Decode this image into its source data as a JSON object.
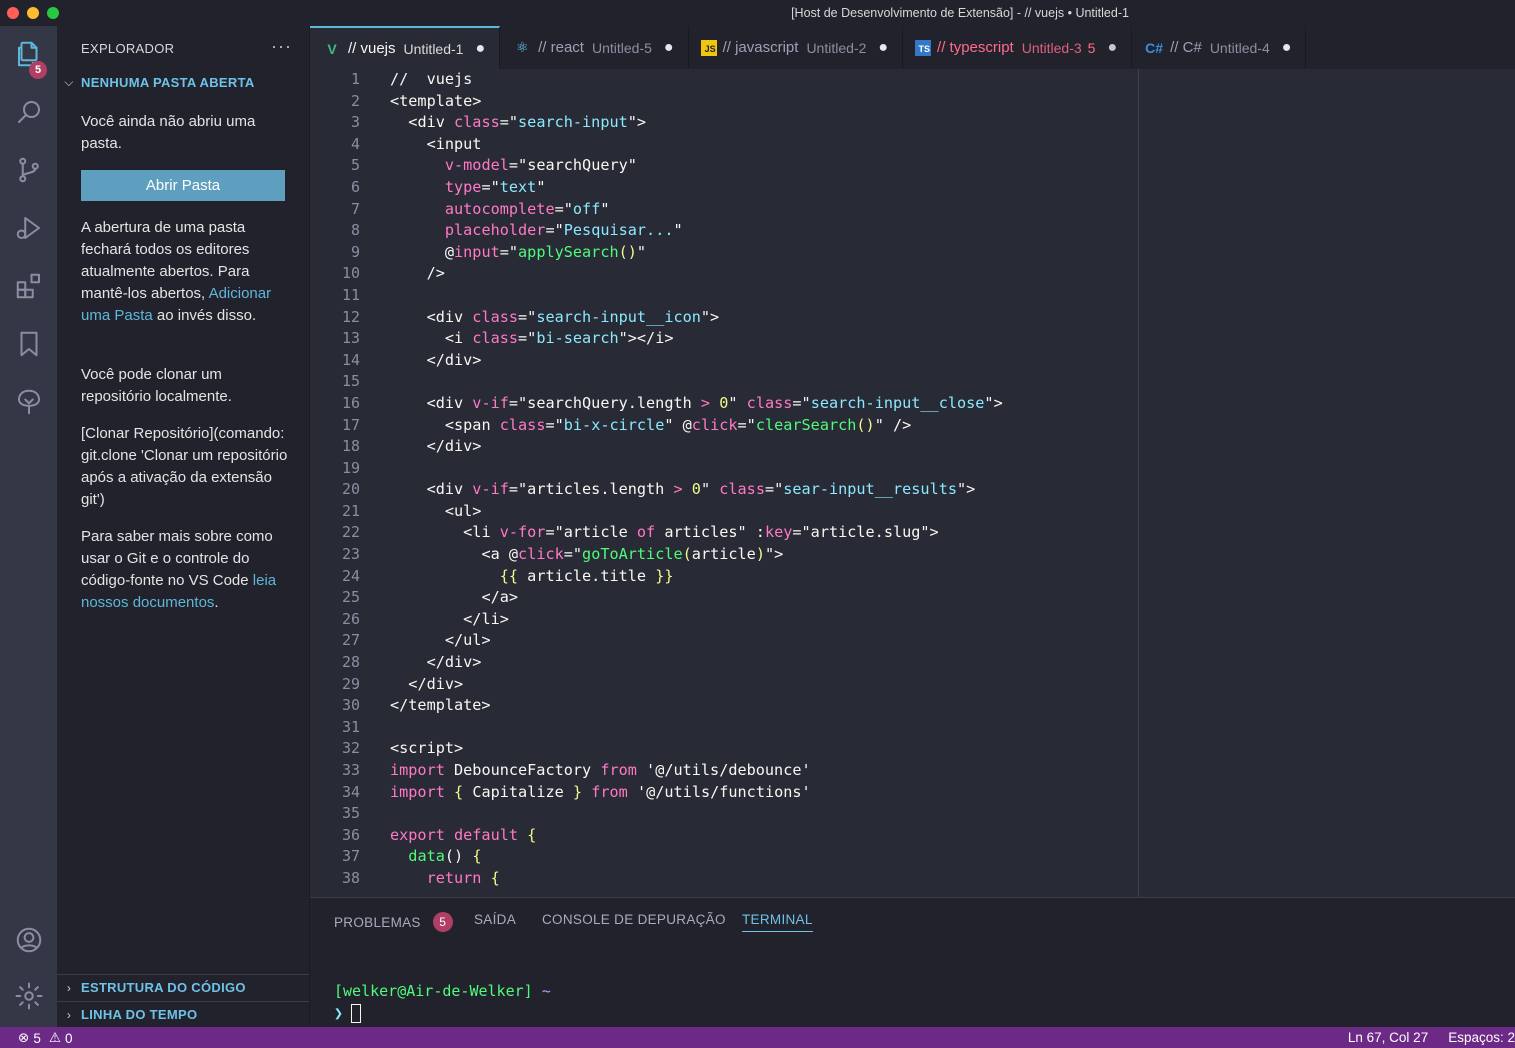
{
  "window": {
    "title": "[Host de Desenvolvimento de Extensão] - // vuejs • Untitled-1"
  },
  "activity": {
    "explorer_badge": "5"
  },
  "sidebar": {
    "title": "EXPLORADOR",
    "more": "···",
    "section_no_folder": "NENHUMA PASTA ABERTA",
    "para1": "Você ainda não abriu uma pasta.",
    "open_folder_button": "Abrir Pasta",
    "para2_a": "A abertura de uma pasta fechará todos os editores atualmente abertos. Para mantê-los abertos, ",
    "para2_link": "Adicionar uma Pasta",
    "para2_b": " ao invés disso.",
    "para3": "Você pode clonar um repositório localmente.",
    "para4": "[Clonar Repositório](comando: git.clone 'Clonar um repositório após a ativação da extensão git')",
    "para5_a": "Para saber mais sobre como usar o Git e o controle do código-fonte no VS Code ",
    "para5_link": "leia nossos documentos",
    "para5_b": ".",
    "section_outline": "ESTRUTURA DO CÓDIGO",
    "section_timeline": "LINHA DO TEMPO"
  },
  "tabs": [
    {
      "icon": "V",
      "icon_color": "#42b883",
      "name": "// vuejs",
      "sub": "Untitled-1",
      "count": "",
      "dot": "●"
    },
    {
      "icon": "⚛",
      "icon_color": "#61dafb",
      "name": "// react",
      "sub": "Untitled-5",
      "count": "",
      "dot": "●"
    },
    {
      "icon": "JS",
      "icon_color": "#f1c40f",
      "name": "// javascript",
      "sub": "Untitled-2",
      "count": "",
      "dot": "●"
    },
    {
      "icon": "TS",
      "icon_color": "#3178c6",
      "name": "// typescript",
      "sub": "Untitled-3",
      "count": "5",
      "dot": "●"
    },
    {
      "icon": "C#",
      "icon_color": "#3a8dde",
      "name": "// C#",
      "sub": "Untitled-4",
      "count": "",
      "dot": "●"
    }
  ],
  "editor": {
    "lines": [
      [
        [
          "t-pl",
          "//  vuejs"
        ]
      ],
      [
        [
          "t-tag",
          "<template>"
        ]
      ],
      [
        [
          "t-pl",
          "  "
        ],
        [
          "t-tag",
          "<div "
        ],
        [
          "t-attr",
          "class"
        ],
        [
          "t-pl",
          "=\""
        ],
        [
          "t-str",
          "search-input"
        ],
        [
          "t-pl",
          "\">"
        ]
      ],
      [
        [
          "t-pl",
          "    "
        ],
        [
          "t-tag",
          "<input"
        ]
      ],
      [
        [
          "t-pl",
          "      "
        ],
        [
          "t-attr",
          "v-model"
        ],
        [
          "t-pl",
          "=\""
        ],
        [
          "t-pl",
          "searchQuery"
        ],
        [
          "t-pl",
          "\""
        ]
      ],
      [
        [
          "t-pl",
          "      "
        ],
        [
          "t-attr",
          "type"
        ],
        [
          "t-pl",
          "=\""
        ],
        [
          "t-str",
          "text"
        ],
        [
          "t-pl",
          "\""
        ]
      ],
      [
        [
          "t-pl",
          "      "
        ],
        [
          "t-attr",
          "autocomplete"
        ],
        [
          "t-pl",
          "=\""
        ],
        [
          "t-str",
          "off"
        ],
        [
          "t-pl",
          "\""
        ]
      ],
      [
        [
          "t-pl",
          "      "
        ],
        [
          "t-attr",
          "placeholder"
        ],
        [
          "t-pl",
          "=\""
        ],
        [
          "t-str",
          "Pesquisar..."
        ],
        [
          "t-pl",
          "\""
        ]
      ],
      [
        [
          "t-pl",
          "      @"
        ],
        [
          "t-attr",
          "input"
        ],
        [
          "t-pl",
          "=\""
        ],
        [
          "t-fn",
          "applySearch"
        ],
        [
          "t-br",
          "()"
        ],
        [
          "t-pl",
          "\""
        ]
      ],
      [
        [
          "t-pl",
          "    />"
        ]
      ],
      [
        [
          "t-pl",
          ""
        ]
      ],
      [
        [
          "t-pl",
          "    "
        ],
        [
          "t-tag",
          "<div "
        ],
        [
          "t-attr",
          "class"
        ],
        [
          "t-pl",
          "=\""
        ],
        [
          "t-str",
          "search-input__icon"
        ],
        [
          "t-pl",
          "\">"
        ]
      ],
      [
        [
          "t-pl",
          "      "
        ],
        [
          "t-tag",
          "<i "
        ],
        [
          "t-attr",
          "class"
        ],
        [
          "t-pl",
          "=\""
        ],
        [
          "t-str",
          "bi-search"
        ],
        [
          "t-pl",
          "\"></i>"
        ]
      ],
      [
        [
          "t-pl",
          "    "
        ],
        [
          "t-tag",
          "</div>"
        ]
      ],
      [
        [
          "t-pl",
          ""
        ]
      ],
      [
        [
          "t-pl",
          "    "
        ],
        [
          "t-tag",
          "<div "
        ],
        [
          "t-attr",
          "v-if"
        ],
        [
          "t-pl",
          "=\""
        ],
        [
          "t-pl",
          "searchQuery.length "
        ],
        [
          "t-kw",
          ">"
        ],
        [
          "t-pl",
          " "
        ],
        [
          "t-br",
          "0"
        ],
        [
          "t-pl",
          "\" "
        ],
        [
          "t-attr",
          "class"
        ],
        [
          "t-pl",
          "=\""
        ],
        [
          "t-str",
          "search-input__close"
        ],
        [
          "t-pl",
          "\">"
        ]
      ],
      [
        [
          "t-pl",
          "      "
        ],
        [
          "t-tag",
          "<span "
        ],
        [
          "t-attr",
          "class"
        ],
        [
          "t-pl",
          "=\""
        ],
        [
          "t-str",
          "bi-x-circle"
        ],
        [
          "t-pl",
          "\" @"
        ],
        [
          "t-attr",
          "click"
        ],
        [
          "t-pl",
          "=\""
        ],
        [
          "t-fn",
          "clearSearch"
        ],
        [
          "t-br",
          "()"
        ],
        [
          "t-pl",
          "\" />"
        ]
      ],
      [
        [
          "t-pl",
          "    "
        ],
        [
          "t-tag",
          "</div>"
        ]
      ],
      [
        [
          "t-pl",
          ""
        ]
      ],
      [
        [
          "t-pl",
          "    "
        ],
        [
          "t-tag",
          "<div "
        ],
        [
          "t-attr",
          "v-if"
        ],
        [
          "t-pl",
          "=\""
        ],
        [
          "t-pl",
          "articles.length "
        ],
        [
          "t-kw",
          ">"
        ],
        [
          "t-pl",
          " "
        ],
        [
          "t-br",
          "0"
        ],
        [
          "t-pl",
          "\" "
        ],
        [
          "t-attr",
          "class"
        ],
        [
          "t-pl",
          "=\""
        ],
        [
          "t-str",
          "sear-input__results"
        ],
        [
          "t-pl",
          "\">"
        ]
      ],
      [
        [
          "t-pl",
          "      "
        ],
        [
          "t-tag",
          "<ul>"
        ]
      ],
      [
        [
          "t-pl",
          "        "
        ],
        [
          "t-tag",
          "<li "
        ],
        [
          "t-attr",
          "v-for"
        ],
        [
          "t-pl",
          "=\""
        ],
        [
          "t-pl",
          "article "
        ],
        [
          "t-kw",
          "of"
        ],
        [
          "t-pl",
          " articles\" :"
        ],
        [
          "t-attr",
          "key"
        ],
        [
          "t-pl",
          "=\""
        ],
        [
          "t-pl",
          "article.slug"
        ],
        [
          "t-pl",
          "\">"
        ]
      ],
      [
        [
          "t-pl",
          "          "
        ],
        [
          "t-tag",
          "<a "
        ],
        [
          "t-pl",
          "@"
        ],
        [
          "t-attr",
          "click"
        ],
        [
          "t-pl",
          "=\""
        ],
        [
          "t-fn",
          "goToArticle"
        ],
        [
          "t-br",
          "("
        ],
        [
          "t-pl",
          "article"
        ],
        [
          "t-br",
          ")"
        ],
        [
          "t-pl",
          "\">"
        ]
      ],
      [
        [
          "t-pl",
          "            "
        ],
        [
          "t-br",
          "{{"
        ],
        [
          "t-pl",
          " article.title "
        ],
        [
          "t-br",
          "}}"
        ]
      ],
      [
        [
          "t-pl",
          "          "
        ],
        [
          "t-tag",
          "</a>"
        ]
      ],
      [
        [
          "t-pl",
          "        "
        ],
        [
          "t-tag",
          "</li>"
        ]
      ],
      [
        [
          "t-pl",
          "      "
        ],
        [
          "t-tag",
          "</ul>"
        ]
      ],
      [
        [
          "t-pl",
          "    "
        ],
        [
          "t-tag",
          "</div>"
        ]
      ],
      [
        [
          "t-pl",
          "  "
        ],
        [
          "t-tag",
          "</div>"
        ]
      ],
      [
        [
          "t-tag",
          "</template>"
        ]
      ],
      [
        [
          "t-pl",
          ""
        ]
      ],
      [
        [
          "t-tag",
          "<script>"
        ]
      ],
      [
        [
          "t-kw",
          "import"
        ],
        [
          "t-pl",
          " DebounceFactory "
        ],
        [
          "t-kw",
          "from"
        ],
        [
          "t-pl",
          " '@/utils/debounce'"
        ]
      ],
      [
        [
          "t-kw",
          "import"
        ],
        [
          "t-pl",
          " "
        ],
        [
          "t-br",
          "{"
        ],
        [
          "t-pl",
          " Capitalize "
        ],
        [
          "t-br",
          "}"
        ],
        [
          "t-pl",
          " "
        ],
        [
          "t-kw",
          "from"
        ],
        [
          "t-pl",
          " '@/utils/functions'"
        ]
      ],
      [
        [
          "t-pl",
          ""
        ]
      ],
      [
        [
          "t-kw",
          "export default"
        ],
        [
          "t-pl",
          " "
        ],
        [
          "t-br",
          "{"
        ]
      ],
      [
        [
          "t-pl",
          "  "
        ],
        [
          "t-fn",
          "data"
        ],
        [
          "t-pl",
          "() "
        ],
        [
          "t-br",
          "{"
        ]
      ],
      [
        [
          "t-pl",
          "    "
        ],
        [
          "t-kw",
          "return"
        ],
        [
          "t-pl",
          " "
        ],
        [
          "t-br",
          "{"
        ]
      ]
    ]
  },
  "panel": {
    "tabs": [
      "PROBLEMAS",
      "SAÍDA",
      "CONSOLE DE DEPURAÇÃO",
      "TERMINAL"
    ],
    "problems_count": "5",
    "terminal_prompt_user": "[welker@Air-de-Welker]",
    "terminal_prompt_dir": " ~",
    "terminal_caret": "❯"
  },
  "status": {
    "errors": "5",
    "warnings": "0",
    "position": "Ln 67, Col 27",
    "spaces": "Espaços: 2"
  }
}
